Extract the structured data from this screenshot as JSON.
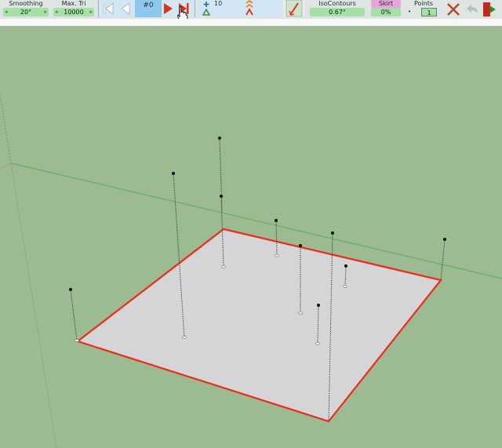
{
  "toolbar": {
    "smoothing": {
      "label": "Smoothing",
      "value": "20°"
    },
    "max_tri": {
      "label": "Max. Tri",
      "value": "10000"
    },
    "playback": {
      "frame": "#0"
    },
    "vertices": {
      "count": "10"
    },
    "iso_contours": {
      "label": "IsoContours",
      "value": "0.67°"
    },
    "skirt": {
      "label": "Skirt",
      "value": "0%"
    },
    "points": {
      "label": "Points",
      "value": "1"
    }
  },
  "colors": {
    "background": "#9cbb92",
    "surface": "#d5d5d7",
    "surface_edge": "#ee2a1a",
    "play_red": "#e0301e",
    "axis_green": "#4fa85c"
  }
}
